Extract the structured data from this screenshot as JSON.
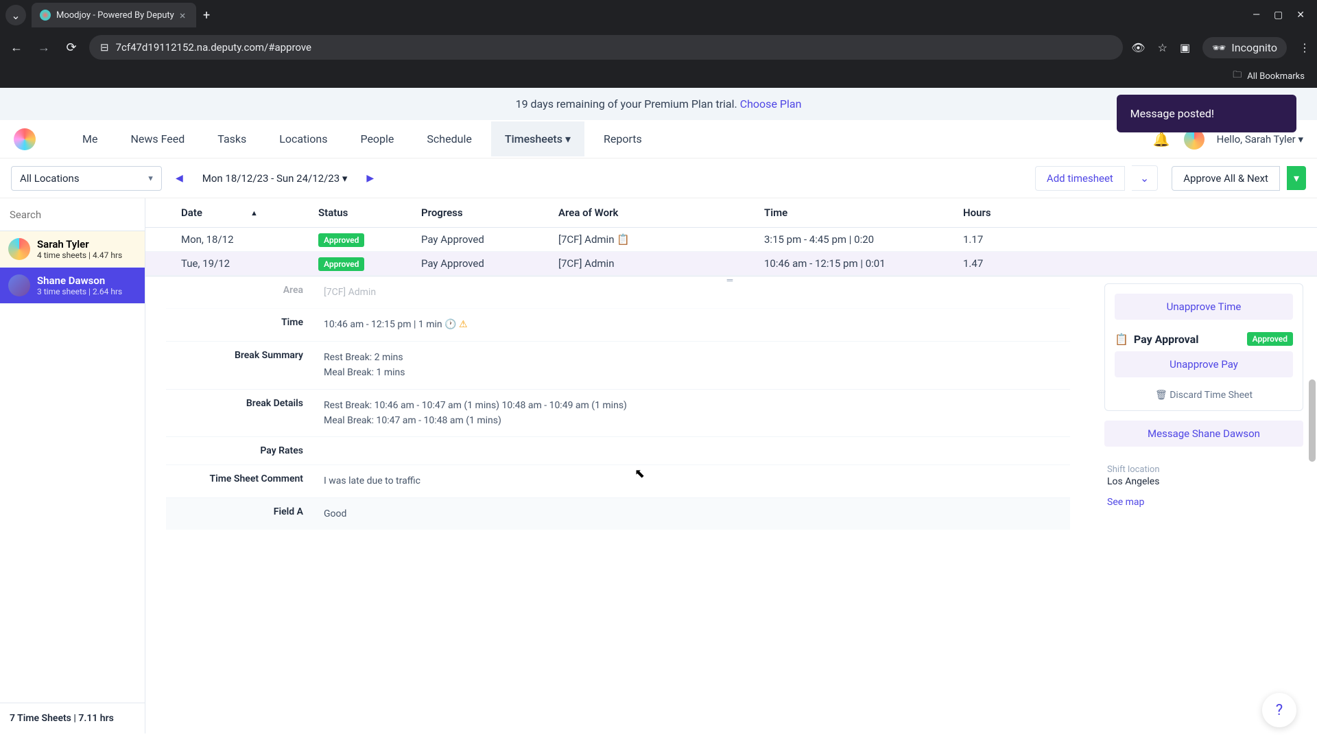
{
  "browser": {
    "tab_title": "Moodjoy - Powered By Deputy",
    "url": "7cf47d19112152.na.deputy.com/#approve",
    "incognito_label": "Incognito",
    "bookmarks_label": "All Bookmarks"
  },
  "banner": {
    "trial_text": "19 days remaining of your Premium Plan trial. ",
    "choose_plan": "Choose Plan"
  },
  "toast": {
    "message": "Message posted!"
  },
  "nav": {
    "items": [
      "Me",
      "News Feed",
      "Tasks",
      "Locations",
      "People",
      "Schedule",
      "Timesheets",
      "Reports"
    ],
    "active_index": 6,
    "greeting": "Hello, Sarah Tyler"
  },
  "toolbar": {
    "location": "All Locations",
    "date_range": "Mon 18/12/23 - Sun 24/12/23",
    "add_label": "Add timesheet",
    "approve_label": "Approve All & Next"
  },
  "sidebar": {
    "search_placeholder": "Search",
    "people": [
      {
        "name": "Sarah Tyler",
        "meta": "4 time sheets | 4.47 hrs"
      },
      {
        "name": "Shane Dawson",
        "meta": "3 time sheets | 2.64 hrs"
      }
    ],
    "footer": "7 Time Sheets | 7.11 hrs"
  },
  "table": {
    "headers": {
      "date": "Date",
      "status": "Status",
      "progress": "Progress",
      "area": "Area of Work",
      "time": "Time",
      "hours": "Hours"
    },
    "rows": [
      {
        "date": "Mon, 18/12",
        "status": "Approved",
        "progress": "Pay Approved",
        "area": "[7CF] Admin 📋",
        "time": "3:15 pm - 4:45 pm | 0:20",
        "hours": "1.17"
      },
      {
        "date": "Tue, 19/12",
        "status": "Approved",
        "progress": "Pay Approved",
        "area": "[7CF] Admin",
        "time": "10:46 am - 12:15 pm | 0:01",
        "hours": "1.47"
      }
    ]
  },
  "detail": {
    "area": {
      "label": "Area",
      "value": "[7CF] Admin"
    },
    "time": {
      "label": "Time",
      "value": "10:46 am - 12:15 pm | 1 min"
    },
    "break_summary": {
      "label": "Break Summary",
      "rest": "Rest Break: 2 mins",
      "meal": "Meal Break: 1 mins"
    },
    "break_details": {
      "label": "Break Details",
      "rest": "Rest Break: 10:46 am - 10:47 am (1 mins) 10:48 am - 10:49 am (1 mins)",
      "meal": "Meal Break: 10:47 am - 10:48 am (1 mins)"
    },
    "pay_rates": {
      "label": "Pay Rates",
      "value": ""
    },
    "comment": {
      "label": "Time Sheet Comment",
      "value": "I was late due to traffic"
    },
    "field_a": {
      "label": "Field A",
      "value": "Good"
    }
  },
  "right": {
    "unapprove_time": "Unapprove Time",
    "pay_approval_label": "Pay Approval",
    "pay_status": "Approved",
    "unapprove_pay": "Unapprove Pay",
    "discard": "Discard Time Sheet",
    "message_btn": "Message Shane Dawson",
    "loc_label": "Shift location",
    "loc_value": "Los Angeles",
    "see_map": "See map"
  }
}
